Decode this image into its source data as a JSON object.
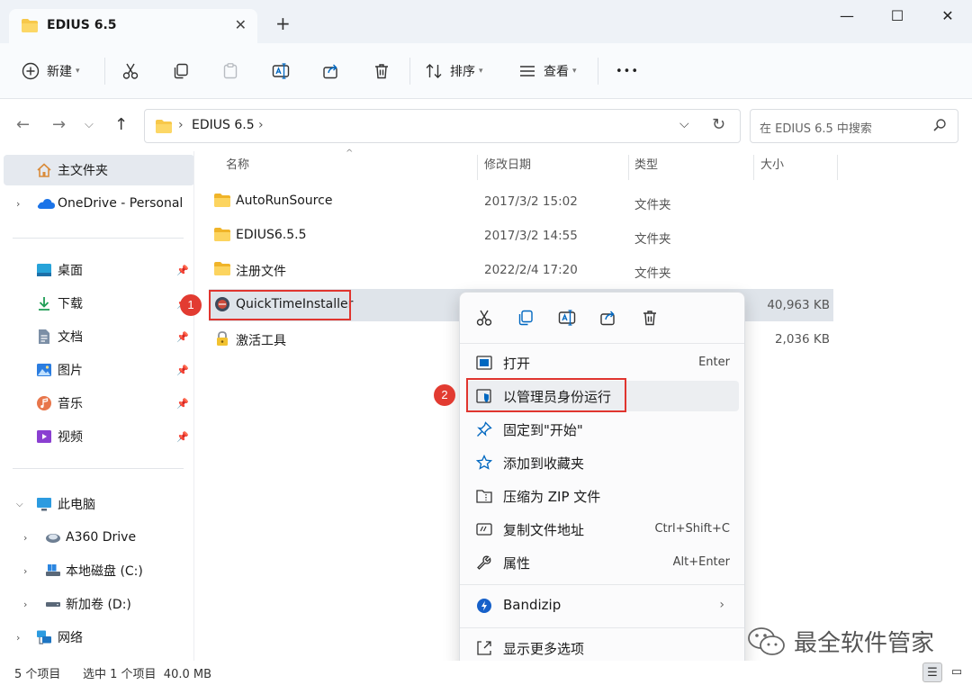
{
  "tab": {
    "title": "EDIUS 6.5",
    "close": "✕",
    "new_tab": "+"
  },
  "window": {
    "minimize": "—",
    "maximize": "☐",
    "close": "✕"
  },
  "toolbar": {
    "new_label": "新建",
    "sort_label": "排序",
    "view_label": "查看",
    "more_label": "•••"
  },
  "address": {
    "path": "EDIUS 6.5",
    "search_placeholder": "在 EDIUS 6.5 中搜索"
  },
  "sidebar": {
    "home": "主文件夹",
    "onedrive": "OneDrive - Personal",
    "quick": [
      "桌面",
      "下载",
      "文档",
      "图片",
      "音乐",
      "视频"
    ],
    "this_pc": "此电脑",
    "drives": [
      "A360 Drive",
      "本地磁盘 (C:)",
      "新加卷 (D:)"
    ],
    "network": "网络"
  },
  "columns": {
    "name": "名称",
    "date": "修改日期",
    "type": "类型",
    "size": "大小"
  },
  "files": [
    {
      "name": "AutoRunSource",
      "date": "2017/3/2 15:02",
      "type": "文件夹",
      "size": ""
    },
    {
      "name": "EDIUS6.5.5",
      "date": "2017/3/2 14:55",
      "type": "文件夹",
      "size": ""
    },
    {
      "name": "注册文件",
      "date": "2022/2/4 17:20",
      "type": "文件夹",
      "size": ""
    },
    {
      "name": "QuickTimeInstaller",
      "date": "",
      "type": "",
      "size": "40,963 KB"
    },
    {
      "name": "激活工具",
      "date": "",
      "type": "",
      "size": "2,036 KB"
    }
  ],
  "badges": {
    "first": "1",
    "second": "2"
  },
  "context_menu": {
    "items": [
      {
        "label": "打开",
        "shortcut": "Enter"
      },
      {
        "label": "以管理员身份运行",
        "shortcut": ""
      },
      {
        "label": "固定到\"开始\"",
        "shortcut": ""
      },
      {
        "label": "添加到收藏夹",
        "shortcut": ""
      },
      {
        "label": "压缩为 ZIP 文件",
        "shortcut": ""
      },
      {
        "label": "复制文件地址",
        "shortcut": "Ctrl+Shift+C"
      },
      {
        "label": "属性",
        "shortcut": "Alt+Enter"
      },
      {
        "label": "Bandizip",
        "shortcut": ""
      },
      {
        "label": "显示更多选项",
        "shortcut": ""
      }
    ]
  },
  "status": {
    "count": "5 个项目",
    "selection": "选中 1 个项目  40.0 MB"
  },
  "watermark": "最全软件管家",
  "colors": {
    "accent": "#0067c0",
    "folder": "#f7c84a",
    "highlight_box": "#e0352f"
  }
}
